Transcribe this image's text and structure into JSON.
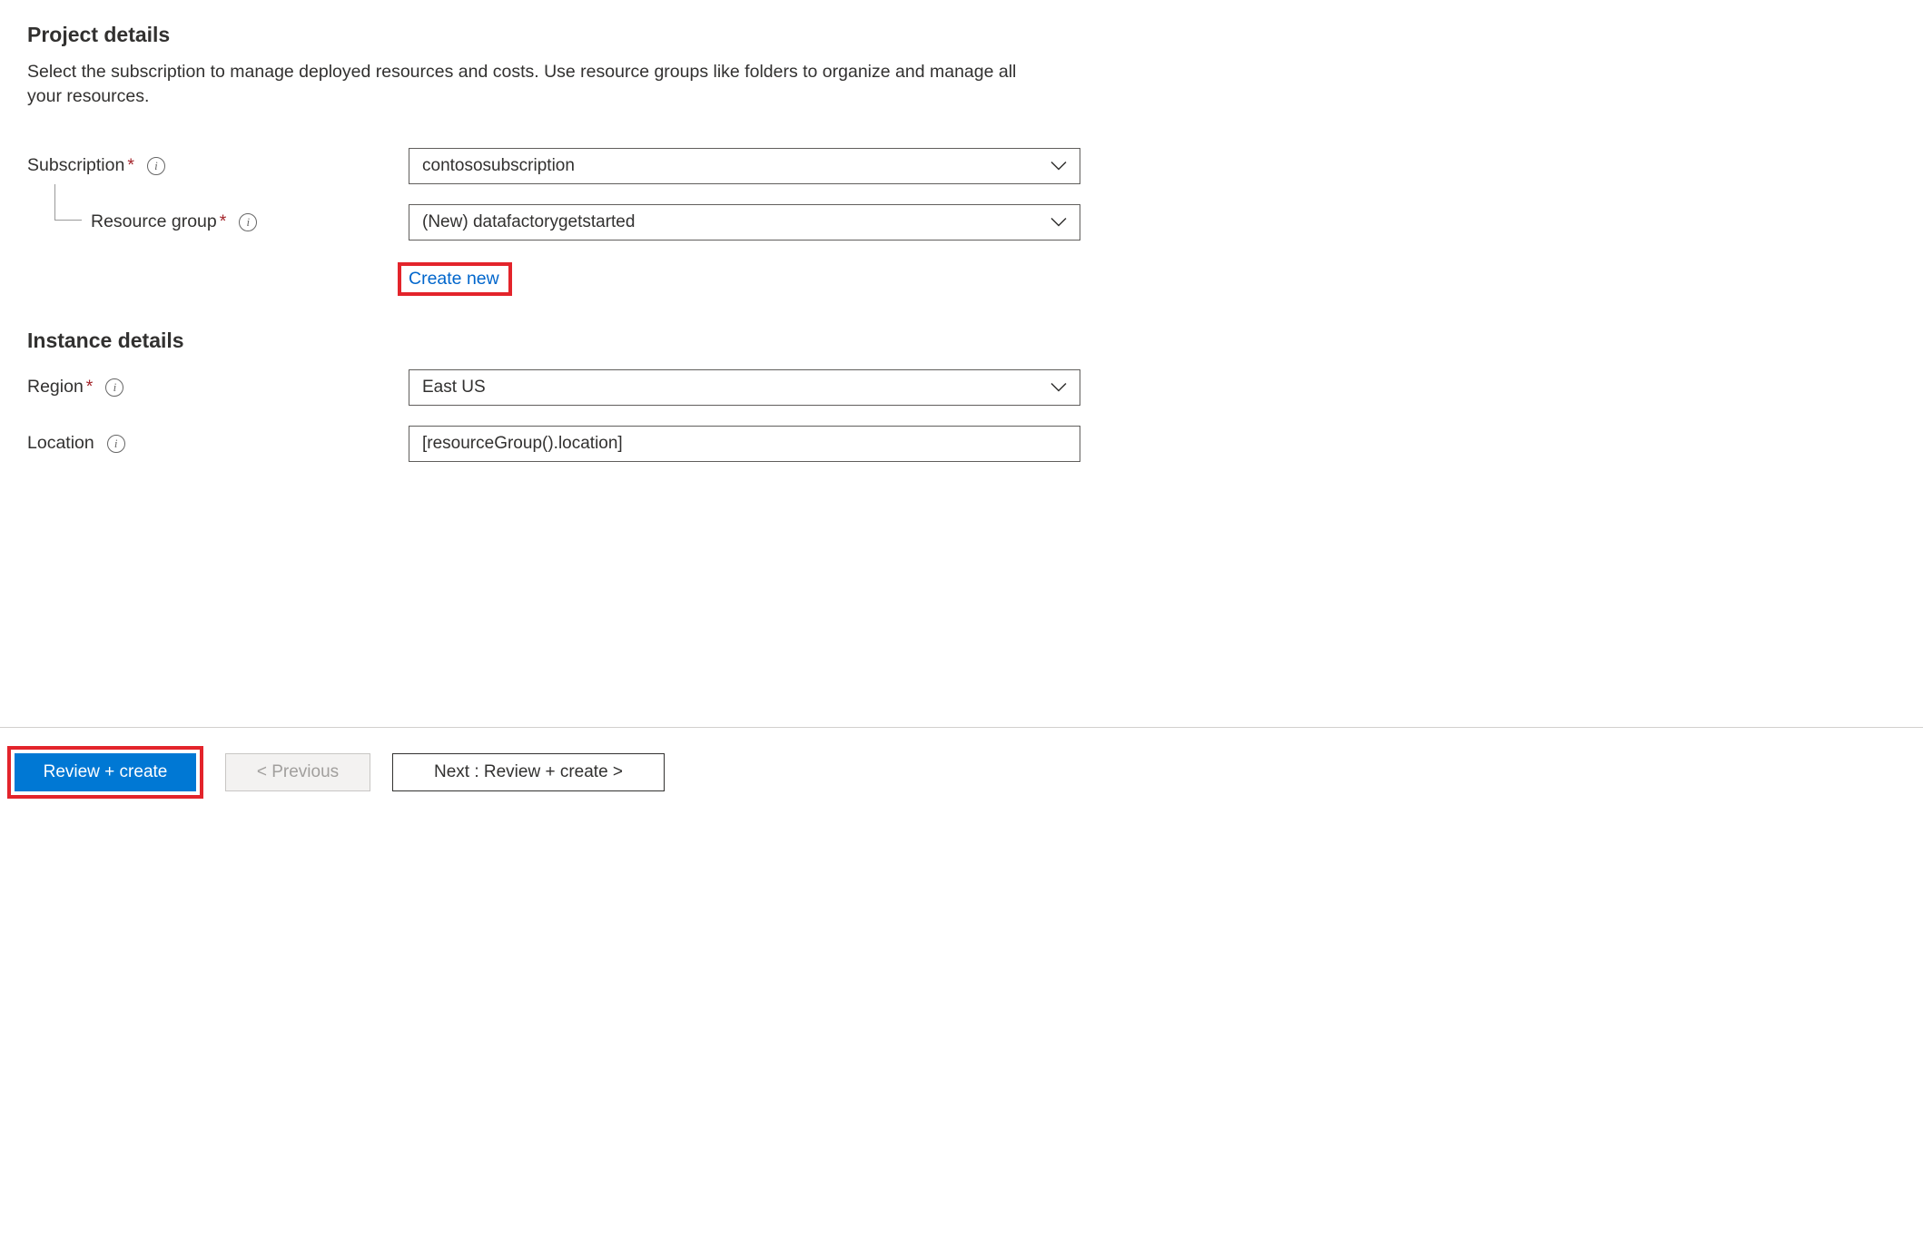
{
  "project_details": {
    "heading": "Project details",
    "description": "Select the subscription to manage deployed resources and costs. Use resource groups like folders to organize and manage all your resources.",
    "subscription": {
      "label": "Subscription",
      "required": "*",
      "value": "contososubscription"
    },
    "resource_group": {
      "label": "Resource group",
      "required": "*",
      "value": "(New) datafactorygetstarted",
      "create_new_label": "Create new"
    }
  },
  "instance_details": {
    "heading": "Instance details",
    "region": {
      "label": "Region",
      "required": "*",
      "value": "East US"
    },
    "location": {
      "label": "Location",
      "value": "[resourceGroup().location]"
    }
  },
  "footer": {
    "review_create": "Review + create",
    "previous": "< Previous",
    "next": "Next : Review + create >"
  },
  "icons": {
    "info_glyph": "i"
  }
}
